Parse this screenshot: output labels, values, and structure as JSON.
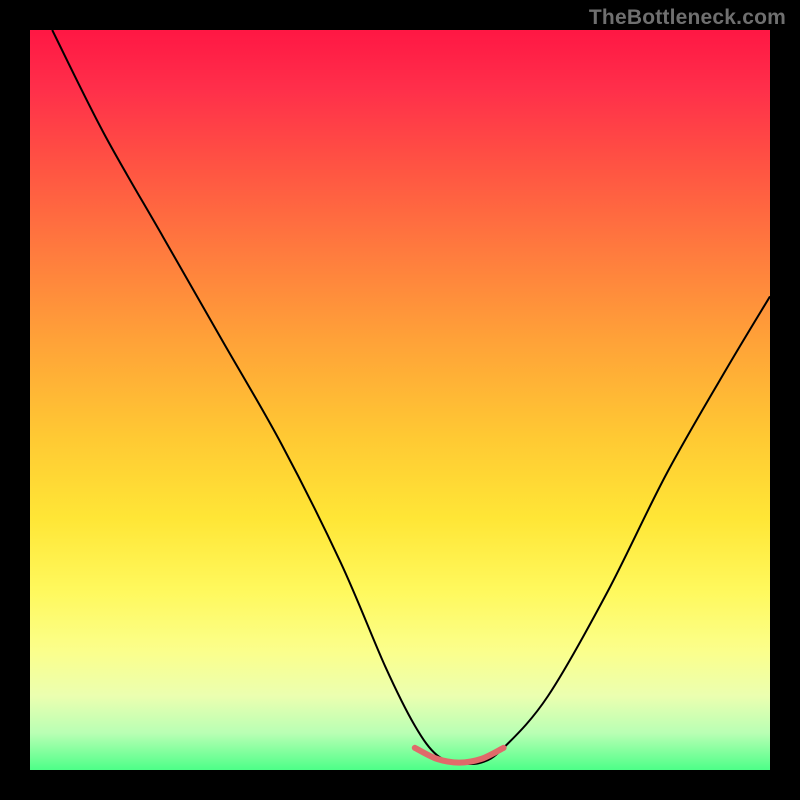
{
  "watermark": {
    "text": "TheBottleneck.com"
  },
  "chart_data": {
    "type": "line",
    "title": "",
    "xlabel": "",
    "ylabel": "",
    "xlim": [
      0,
      100
    ],
    "ylim": [
      0,
      100
    ],
    "grid": false,
    "legend": false,
    "background_gradient": {
      "direction": "top-to-bottom",
      "stops": [
        {
          "pct": 0,
          "color": "#ff1744"
        },
        {
          "pct": 50,
          "color": "#ffc933"
        },
        {
          "pct": 100,
          "color": "#4dff88"
        }
      ]
    },
    "series": [
      {
        "name": "main-curve",
        "color": "#000000",
        "width": 2,
        "x": [
          3,
          10,
          18,
          26,
          34,
          42,
          48,
          52,
          55,
          58,
          61,
          64,
          70,
          78,
          86,
          94,
          100
        ],
        "y": [
          100,
          86,
          72,
          58,
          44,
          28,
          14,
          6,
          2,
          1,
          1,
          3,
          10,
          24,
          40,
          54,
          64
        ]
      },
      {
        "name": "bottom-marker",
        "color": "#e06a6a",
        "width": 6,
        "x": [
          52,
          55,
          58,
          61,
          64
        ],
        "y": [
          3,
          1.5,
          1,
          1.5,
          3
        ]
      }
    ],
    "annotations": []
  }
}
